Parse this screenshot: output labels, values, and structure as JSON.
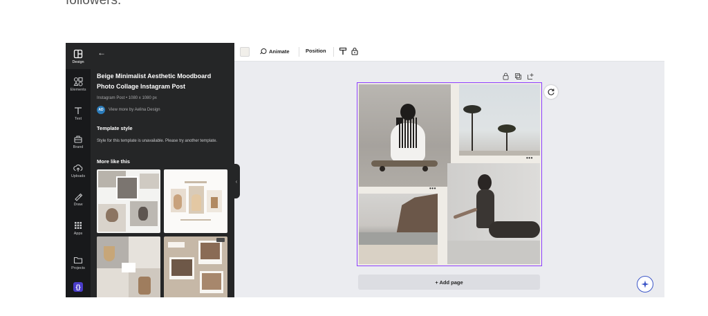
{
  "intro_text": "followers.",
  "rail": {
    "items": [
      {
        "label": "Design",
        "icon": "design-icon"
      },
      {
        "label": "Elements",
        "icon": "elements-icon"
      },
      {
        "label": "Text",
        "icon": "text-icon"
      },
      {
        "label": "Brand",
        "icon": "brand-icon"
      },
      {
        "label": "Uploads",
        "icon": "uploads-icon"
      },
      {
        "label": "Draw",
        "icon": "draw-icon"
      },
      {
        "label": "Apps",
        "icon": "apps-icon"
      },
      {
        "label": "Projects",
        "icon": "projects-icon"
      },
      {
        "label": "",
        "icon": "app-icon"
      }
    ]
  },
  "panel": {
    "title": "Beige Minimalist Aesthetic Moodboard Photo Collage Instagram Post",
    "meta": "Instagram Post • 1080 x 1080 px",
    "author_initials": "AD",
    "author_link": "View more by Aelina Design",
    "template_style_heading": "Template style",
    "template_style_desc": "Style for this template is unavailable. Please try another template.",
    "more_like_heading": "More like this"
  },
  "toolbar": {
    "animate": "Animate",
    "position": "Position"
  },
  "canvas": {
    "add_page": "+ Add page",
    "more_dots": "•••"
  },
  "colors": {
    "accent": "#8b3dff",
    "panel_bg": "#252627",
    "rail_bg": "#18191b",
    "workspace_bg": "#ebecf0"
  }
}
